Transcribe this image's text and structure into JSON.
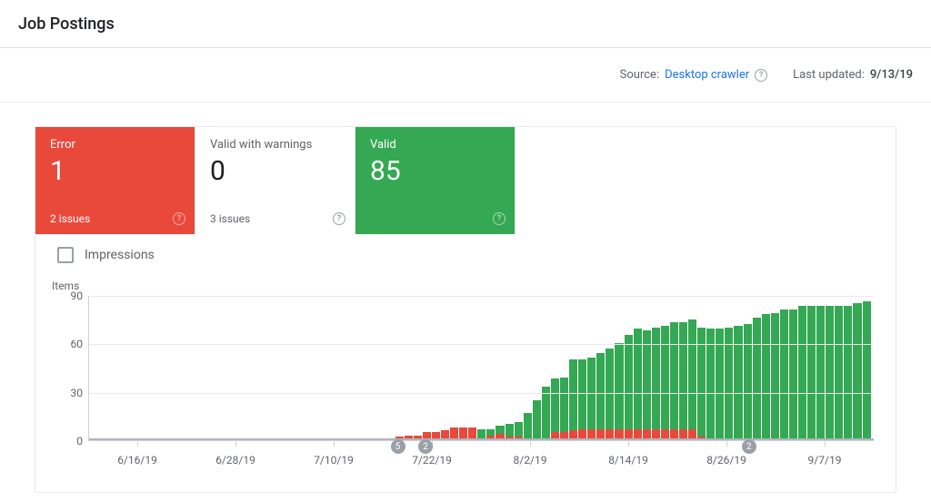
{
  "header": {
    "title": "Job Postings"
  },
  "meta": {
    "source_label": "Source:",
    "source_value": "Desktop crawler",
    "last_updated_label": "Last updated:",
    "last_updated_value": "9/13/19"
  },
  "tiles": {
    "error": {
      "label": "Error",
      "value": "1",
      "footer": "2 issues"
    },
    "warning": {
      "label": "Valid with warnings",
      "value": "0",
      "footer": "3 issues"
    },
    "valid": {
      "label": "Valid",
      "value": "85",
      "footer": ""
    }
  },
  "impressions": {
    "label": "Impressions",
    "checked": false
  },
  "chart_data": {
    "type": "bar",
    "title": "",
    "xlabel": "",
    "ylabel": "Items",
    "ylim": [
      0,
      90
    ],
    "y_ticks": [
      0,
      30,
      60,
      90
    ],
    "categories": [
      "6/16/19",
      "6/28/19",
      "7/10/19",
      "7/22/19",
      "8/2/19",
      "8/14/19",
      "8/26/19",
      "9/7/19"
    ],
    "series": [
      {
        "name": "Valid (green)",
        "values": [
          0,
          0,
          0,
          0,
          0,
          0,
          0,
          0,
          0,
          0,
          0,
          0,
          0,
          0,
          0,
          0,
          0,
          0,
          0,
          0,
          0,
          0,
          0,
          0,
          0,
          0,
          0,
          0,
          0,
          0,
          0,
          0,
          0,
          0,
          0,
          0,
          0,
          0,
          0,
          0,
          0,
          0,
          6,
          4,
          5,
          8,
          9,
          16,
          24,
          32,
          33,
          34,
          44,
          43,
          44,
          47,
          50,
          53,
          58,
          62,
          61,
          63,
          64,
          66,
          66,
          68,
          68,
          69,
          69,
          70,
          71,
          72,
          76,
          77,
          78,
          80,
          80,
          82,
          82,
          82,
          82,
          82,
          82,
          84,
          85
        ]
      },
      {
        "name": "Error (red)",
        "values": [
          0,
          0,
          0,
          0,
          0,
          0,
          0,
          0,
          0,
          0,
          0,
          0,
          0,
          0,
          0,
          0,
          0,
          0,
          0,
          0,
          0,
          0,
          0,
          0,
          0,
          0,
          0,
          0,
          0,
          0,
          0,
          0,
          1,
          2,
          3,
          3,
          5,
          5,
          6,
          8,
          8,
          8,
          1,
          3,
          4,
          2,
          2,
          1,
          1,
          1,
          5,
          5,
          6,
          7,
          7,
          7,
          7,
          7,
          7,
          7,
          7,
          7,
          7,
          7,
          7,
          7,
          2,
          0,
          0,
          0,
          0,
          0,
          0,
          1,
          1,
          1,
          1,
          1,
          1,
          1,
          1,
          1,
          1,
          1,
          1
        ]
      }
    ],
    "markers": [
      {
        "position_index": 33,
        "label": "5"
      },
      {
        "position_index": 36,
        "label": "2"
      },
      {
        "position_index": 71,
        "label": "2"
      }
    ]
  }
}
